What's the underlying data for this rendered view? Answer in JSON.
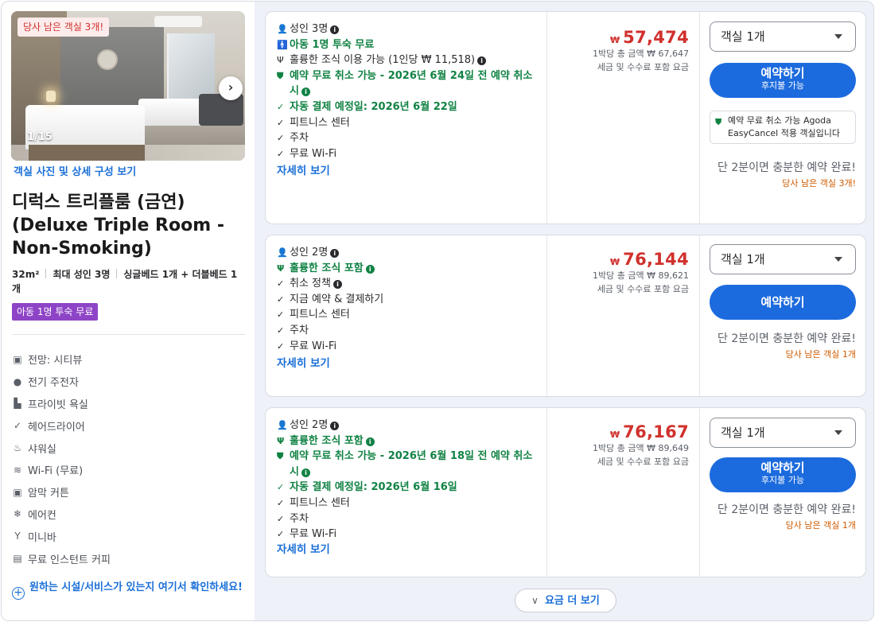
{
  "room": {
    "photo_badge": "당사 남은 객실 3개!",
    "photo_counter": "1/15",
    "photo_link": "객실 사진 및 상세 구성 보기",
    "title": "디럭스 트리플룸 (금연) (Deluxe Triple Room - Non-Smoking)",
    "size": "32m²",
    "max_guests": "최대 성인 3명",
    "beds": "싱글베드 1개 + 더블베드 1개",
    "child_badge": "아동 1명 투숙 무료",
    "amenities": [
      {
        "icon": "view-icon",
        "label": "전망: 시티뷰"
      },
      {
        "icon": "ev-charger-icon",
        "label": "전기 주전자"
      },
      {
        "icon": "bathtub-icon",
        "label": "프라이빗 욕실"
      },
      {
        "icon": "hairdryer-icon",
        "label": "헤어드라이어"
      },
      {
        "icon": "shower-icon",
        "label": "샤워실"
      },
      {
        "icon": "wifi-icon",
        "label": "Wi-Fi (무료)"
      },
      {
        "icon": "blackout-curtain-icon",
        "label": "암막 커튼"
      },
      {
        "icon": "air-conditioner-icon",
        "label": "에어컨"
      },
      {
        "icon": "minibar-icon",
        "label": "미니바"
      },
      {
        "icon": "coffee-icon",
        "label": "무료 인스턴트 커피"
      }
    ],
    "facility_link": "원하는 시설/서비스가 있는지 여기서 확인하세요!"
  },
  "offers": [
    {
      "features": [
        {
          "icon": "person-icon",
          "text": "성인 3명",
          "info": true,
          "green": false
        },
        {
          "icon": "child-icon",
          "text": "아동 1명 투숙 무료",
          "info": false,
          "green": true
        },
        {
          "icon": "cutlery-icon",
          "text": "훌륭한 조식 이용 가능 (1인당 ₩ 11,518)",
          "info": true,
          "green": false
        },
        {
          "icon": "shield-icon",
          "text": "예약 무료 취소 가능 - 2026년 6월 24일 전 예약 취소 시",
          "info": true,
          "green": true
        },
        {
          "icon": "check-icon",
          "text": "자동 결제 예정일: 2026년 6월 22일",
          "info": false,
          "green": true
        },
        {
          "icon": "check-icon",
          "text": "피트니스 센터",
          "info": false,
          "green": false
        },
        {
          "icon": "check-icon",
          "text": "주차",
          "info": false,
          "green": false
        },
        {
          "icon": "check-icon",
          "text": "무료 Wi-Fi",
          "info": false,
          "green": false
        }
      ],
      "more_link": "자세히 보기",
      "currency": "₩",
      "price": "57,474",
      "total_line": "1박당 총 금액 ₩ 67,647",
      "tax_line": "세금 및 수수료 포함 요금",
      "room_select": "객실 1개",
      "book_label": "예약하기",
      "book_sub": "후지불 가능",
      "easycancel": "예약 무료 취소 가능 Agoda EasyCancel 적용 객실입니다",
      "hint": "단 2분이면 충분한 예약 완료!",
      "scarcity": "당사 남은 객실 3개!"
    },
    {
      "features": [
        {
          "icon": "person-icon",
          "text": "성인 2명",
          "info": true,
          "green": false
        },
        {
          "icon": "cutlery-icon",
          "text": "훌륭한 조식 포함",
          "info": true,
          "green": true
        },
        {
          "icon": "check-icon",
          "text": "취소 정책",
          "info": true,
          "green": false
        },
        {
          "icon": "check-icon",
          "text": "지금 예약 & 결제하기",
          "info": false,
          "green": false
        },
        {
          "icon": "check-icon",
          "text": "피트니스 센터",
          "info": false,
          "green": false
        },
        {
          "icon": "check-icon",
          "text": "주차",
          "info": false,
          "green": false
        },
        {
          "icon": "check-icon",
          "text": "무료 Wi-Fi",
          "info": false,
          "green": false
        }
      ],
      "more_link": "자세히 보기",
      "currency": "₩",
      "price": "76,144",
      "total_line": "1박당 총 금액 ₩ 89,621",
      "tax_line": "세금 및 수수료 포함 요금",
      "room_select": "객실 1개",
      "book_label": "예약하기",
      "book_sub": "",
      "hint": "단 2분이면 충분한 예약 완료!",
      "scarcity": "당사 남은 객실 1개"
    },
    {
      "features": [
        {
          "icon": "person-icon",
          "text": "성인 2명",
          "info": true,
          "green": false
        },
        {
          "icon": "cutlery-icon",
          "text": "훌륭한 조식 포함",
          "info": true,
          "green": true
        },
        {
          "icon": "shield-icon",
          "text": "예약 무료 취소 가능 - 2026년 6월 18일 전 예약 취소 시",
          "info": true,
          "green": true
        },
        {
          "icon": "check-icon",
          "text": "자동 결제 예정일: 2026년 6월 16일",
          "info": false,
          "green": true
        },
        {
          "icon": "check-icon",
          "text": "피트니스 센터",
          "info": false,
          "green": false
        },
        {
          "icon": "check-icon",
          "text": "주차",
          "info": false,
          "green": false
        },
        {
          "icon": "check-icon",
          "text": "무료 Wi-Fi",
          "info": false,
          "green": false
        }
      ],
      "more_link": "자세히 보기",
      "currency": "₩",
      "price": "76,167",
      "total_line": "1박당 총 금액 ₩ 89,649",
      "tax_line": "세금 및 수수료 포함 요금",
      "room_select": "객실 1개",
      "book_label": "예약하기",
      "book_sub": "후지불 가능",
      "hint": "단 2분이면 충분한 예약 완료!",
      "scarcity": "당사 남은 객실 1개"
    }
  ],
  "more_rates": "요금 더 보기",
  "colors": {
    "accent": "#1c6bde",
    "price": "#d0312d",
    "green": "#118244",
    "purple": "#8e44c6"
  }
}
